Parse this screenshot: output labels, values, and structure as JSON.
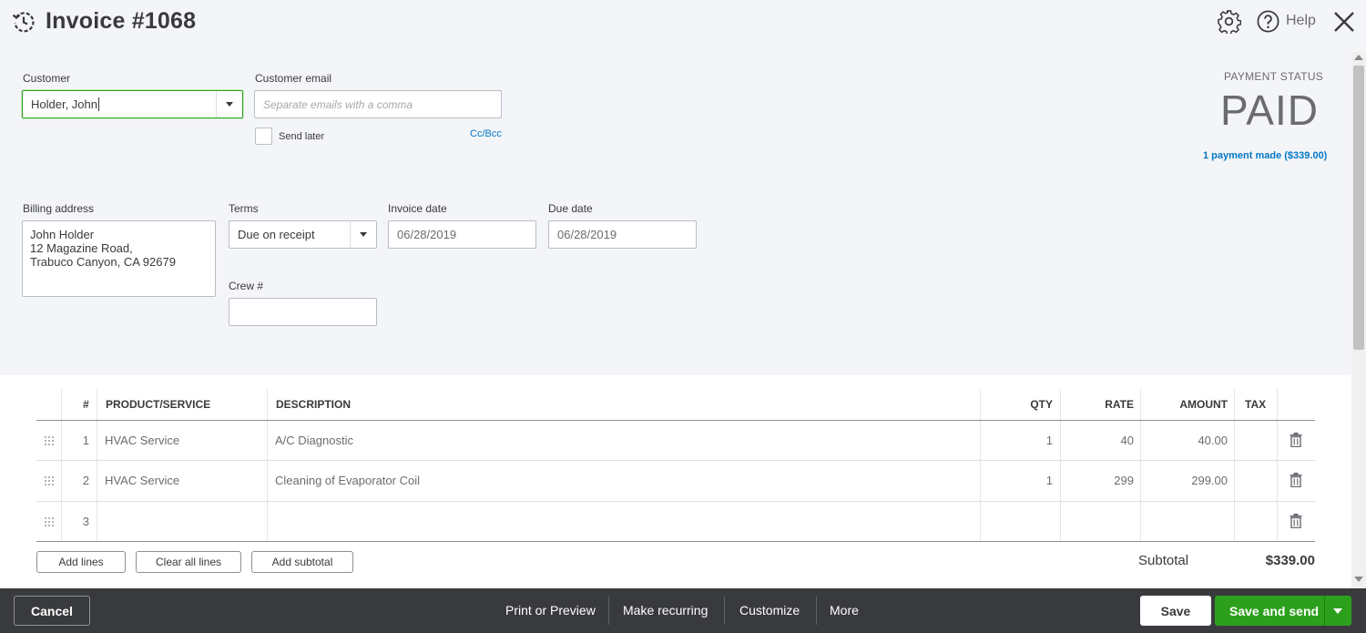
{
  "header": {
    "title": "Invoice #1068",
    "help_label": "Help"
  },
  "customer": {
    "label": "Customer",
    "value": "Holder, John",
    "email_label": "Customer email",
    "email_placeholder": "Separate emails with a comma",
    "send_later_label": "Send later",
    "cc_bcc_label": "Cc/Bcc"
  },
  "payment": {
    "status_label": "PAYMENT STATUS",
    "status_value": "PAID",
    "payment_link": "1 payment made ($339.00)"
  },
  "billing": {
    "label": "Billing address",
    "lines": [
      "John Holder",
      "12 Magazine Road,",
      "Trabuco Canyon, CA  92679"
    ]
  },
  "terms": {
    "label": "Terms",
    "value": "Due on receipt"
  },
  "invoice_date": {
    "label": "Invoice date",
    "value": "06/28/2019"
  },
  "due_date": {
    "label": "Due date",
    "value": "06/28/2019"
  },
  "crew": {
    "label": "Crew #",
    "value": ""
  },
  "table": {
    "headers": {
      "num": "#",
      "product": "PRODUCT/SERVICE",
      "description": "DESCRIPTION",
      "qty": "QTY",
      "rate": "RATE",
      "amount": "AMOUNT",
      "tax": "TAX"
    },
    "rows": [
      {
        "num": "1",
        "product": "HVAC Service",
        "description": "A/C Diagnostic",
        "qty": "1",
        "rate": "40",
        "amount": "40.00"
      },
      {
        "num": "2",
        "product": "HVAC Service",
        "description": "Cleaning of Evaporator Coil",
        "qty": "1",
        "rate": "299",
        "amount": "299.00"
      },
      {
        "num": "3",
        "product": "",
        "description": "",
        "qty": "",
        "rate": "",
        "amount": ""
      }
    ]
  },
  "line_actions": {
    "add_lines": "Add lines",
    "clear_all": "Clear all lines",
    "add_subtotal": "Add subtotal"
  },
  "subtotal": {
    "label": "Subtotal",
    "value": "$339.00"
  },
  "footer": {
    "cancel": "Cancel",
    "print_preview": "Print or Preview",
    "make_recurring": "Make recurring",
    "customize": "Customize",
    "more": "More",
    "save": "Save",
    "save_and_send": "Save and send"
  },
  "colors": {
    "accent_green": "#2ca01c",
    "link_blue": "#0077c5",
    "footer_bg": "#393a3d"
  }
}
